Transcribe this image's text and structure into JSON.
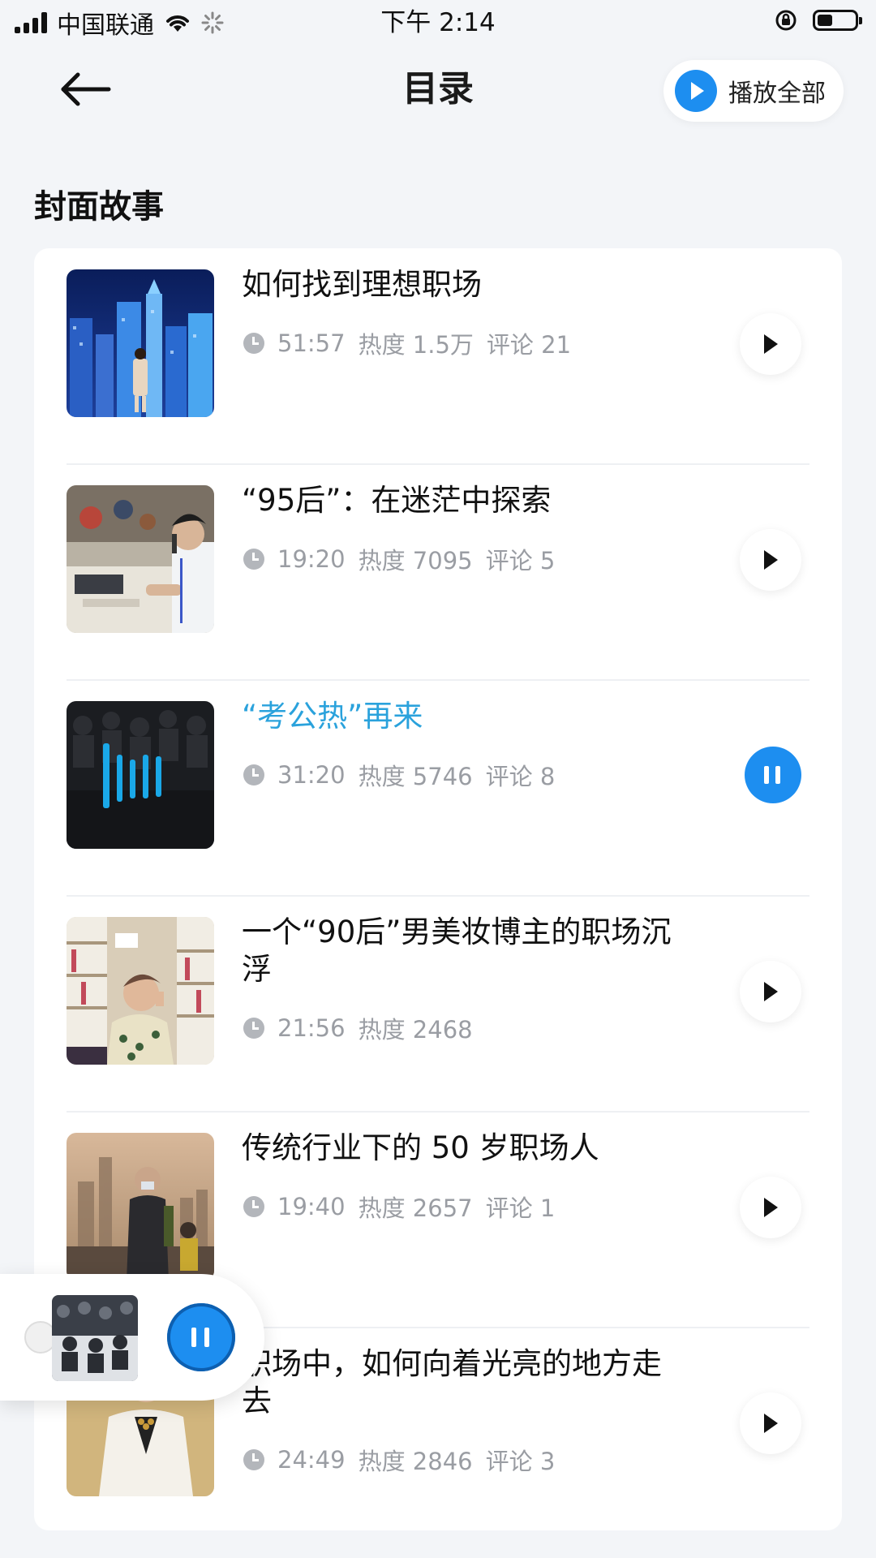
{
  "status_bar": {
    "carrier": "中国联通",
    "time": "下午 2:14",
    "battery_level": 0.4
  },
  "nav": {
    "title": "目录",
    "play_all_label": "播放全部",
    "accent_color": "#1d8ef0"
  },
  "section": {
    "title": "封面故事"
  },
  "episodes": [
    {
      "title": "如何找到理想职场",
      "duration": "51:57",
      "heat": "热度 1.5万",
      "comments": "评论 21",
      "state": "paused",
      "thumb": "city-night-skyline"
    },
    {
      "title": "“95后”：在迷茫中探索",
      "duration": "19:20",
      "heat": "热度 7095",
      "comments": "评论 5",
      "state": "paused",
      "thumb": "office-worker-headset"
    },
    {
      "title": "“考公热”再来",
      "duration": "31:20",
      "heat": "热度 5746",
      "comments": "评论 8",
      "state": "playing",
      "thumb": "exam-hall-with-audio-bars"
    },
    {
      "title": "一个“90后”男美妆博主的职场沉浮",
      "duration": "21:56",
      "heat": "热度 2468",
      "comments": "",
      "state": "paused",
      "thumb": "beauty-blogger-shelves"
    },
    {
      "title": "传统行业下的 50 岁职场人",
      "duration": "19:40",
      "heat": "热度 2657",
      "comments": "评论 1",
      "state": "paused",
      "thumb": "masked-man-city"
    },
    {
      "title": "职场中，如何向着光亮的地方走去",
      "duration": "24:49",
      "heat": "热度 2846",
      "comments": "评论 3",
      "state": "paused",
      "thumb": "woman-white-blazer"
    }
  ],
  "mini_player": {
    "state": "playing",
    "thumb": "exam-hall"
  }
}
